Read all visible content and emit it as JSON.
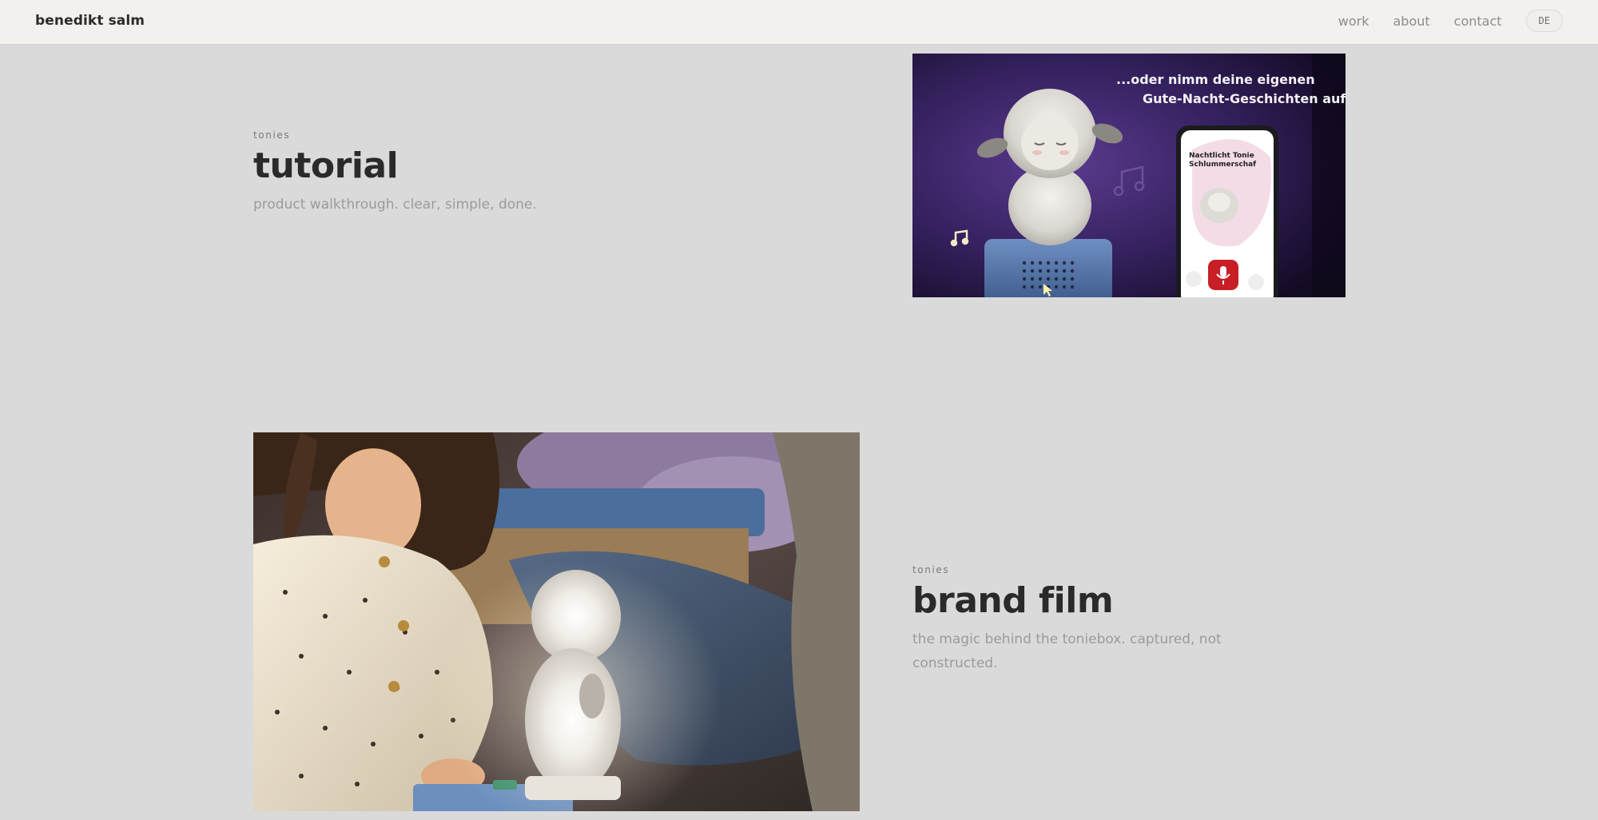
{
  "header": {
    "brand": "benedikt salm",
    "nav": {
      "work": "work",
      "about": "about",
      "contact": "contact"
    },
    "language_button": "DE"
  },
  "projects": [
    {
      "client": "tonies",
      "title": "tutorial",
      "description": "product walkthrough. clear, simple, done.",
      "thumbnail": {
        "caption_line1": "...oder nimm deine eigenen",
        "caption_line2": "Gute-Nacht-Geschichten auf.",
        "phone_title_line1": "Nachtlicht Tonie",
        "phone_title_line2": "Schlummerschaf"
      }
    },
    {
      "client": "tonies",
      "title": "brand film",
      "description_line1": "the magic behind the toniebox. captured, not",
      "description_line2": "constructed."
    }
  ],
  "colors": {
    "page_background": "#dbdada",
    "header_background": "#f2f1ee",
    "title_text": "#2a2a2a",
    "muted_text": "#9c9b99",
    "record_button": "#c81e26"
  },
  "icons": {
    "music_note": "music-note-icon",
    "microphone": "microphone-icon"
  }
}
